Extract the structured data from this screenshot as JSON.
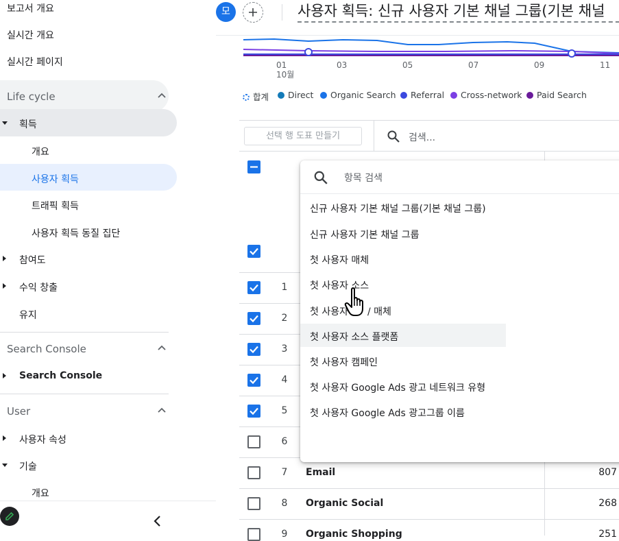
{
  "sidebar": {
    "top_items": [
      "보고서 개요",
      "실시간 개요",
      "실시간 페이지"
    ],
    "lifecycle": {
      "title": "Life cycle",
      "acquisition": "획득",
      "acquisition_sub": [
        "개요",
        "사용자 획득",
        "트래픽 획득",
        "사용자 획득 동질 집단"
      ],
      "engagement": "참여도",
      "monetization": "수익 창출",
      "retention": "유지"
    },
    "search_console": {
      "title": "Search Console",
      "item": "Search Console"
    },
    "user": {
      "title": "User",
      "attributes": "사용자 속성",
      "tech": "기술",
      "tech_sub": "개요"
    }
  },
  "header": {
    "avatar": "모",
    "title": "사용자 획득: 신규 사용자 기본 채널 그룹(기본 채널"
  },
  "chart_data": {
    "type": "line",
    "x": [
      "01",
      "03",
      "05",
      "07",
      "09",
      "11"
    ],
    "x_sublabel": "10월",
    "legend": [
      {
        "name": "합계",
        "color": "#1a73e8",
        "style": "dashed-ring"
      },
      {
        "name": "Direct",
        "color": "#137ab8"
      },
      {
        "name": "Organic Search",
        "color": "#1a73e8"
      },
      {
        "name": "Referral",
        "color": "#3b49df"
      },
      {
        "name": "Cross-network",
        "color": "#7b3fe4"
      },
      {
        "name": "Paid Search",
        "color": "#6a1b9a"
      }
    ]
  },
  "toolbar": {
    "plot_button": "선택 행 도표 만들기",
    "search_placeholder": "검색..."
  },
  "dropdown": {
    "search_placeholder": "항목 검색",
    "items": [
      "신규 사용자 기본 채널 그룹(기본 채널 그룹)",
      "신규 사용자 기본 채널 그룹",
      "첫 사용자 매체",
      "첫 사용자 소스",
      "첫 사용자 소스 / 매체",
      "첫 사용자 소스 플랫폼",
      "첫 사용자 캠페인",
      "첫 사용자 Google Ads 광고 네트워크 유형",
      "첫 사용자 Google Ads 광고그룹 이름"
    ],
    "partial_item_left": "첫 사용자",
    "partial_item_right": "/ 매체"
  },
  "table": {
    "rows": [
      {
        "num": "1",
        "checked": true
      },
      {
        "num": "2",
        "checked": true
      },
      {
        "num": "3",
        "checked": true
      },
      {
        "num": "4",
        "checked": true
      },
      {
        "num": "5",
        "checked": true
      },
      {
        "num": "6",
        "checked": false
      },
      {
        "num": "7",
        "name": "Email",
        "value": "807",
        "checked": false
      },
      {
        "num": "8",
        "name": "Organic Social",
        "value": "268",
        "checked": false
      },
      {
        "num": "9",
        "name": "Organic Shopping",
        "value": "251",
        "checked": false
      }
    ]
  }
}
